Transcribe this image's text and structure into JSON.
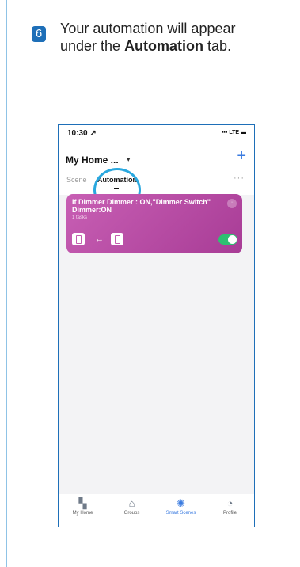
{
  "step": {
    "number": "6",
    "text_before": "Your automation will appear under the ",
    "text_bold": "Automation",
    "text_after": " tab."
  },
  "phone": {
    "status": {
      "time": "10:30 ↗",
      "signal": "▪▪▪ LTE ▬"
    },
    "header": {
      "title": "My Home ...",
      "chevron": "▾",
      "add_label": "+",
      "tabs": [
        {
          "label": "Scene"
        },
        {
          "label": "Automation"
        }
      ],
      "more": "···"
    },
    "card": {
      "title": "If Dimmer Dimmer : ON,\"Dimmer Switch\" Dimmer:ON",
      "subtitle": "1 tasks",
      "menu": "···",
      "arrow": "↔",
      "toggle_on": true
    },
    "nav": [
      {
        "label": "My Home",
        "icon": "grid-icon"
      },
      {
        "label": "Groups",
        "icon": "house-icon"
      },
      {
        "label": "Smart Scenes",
        "icon": "sun-icon"
      },
      {
        "label": "Profile",
        "icon": "profile-icon"
      }
    ]
  }
}
